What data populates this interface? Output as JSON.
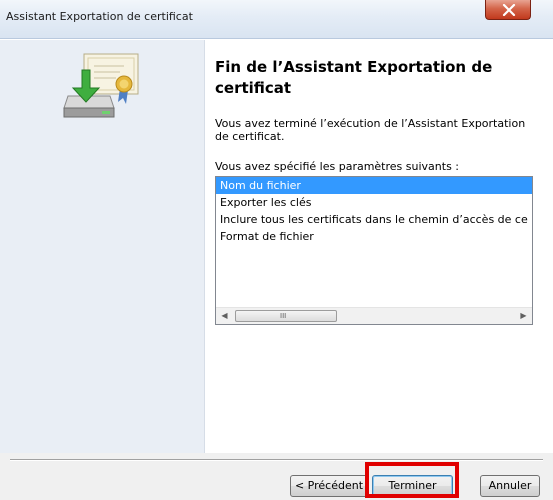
{
  "window": {
    "title": "Assistant Exportation de certificat",
    "close_icon": "close-icon"
  },
  "main": {
    "heading": "Fin de l’Assistant Exportation de certificat",
    "completion_text": "Vous avez terminé l’exécution de l’Assistant Exportation de certificat.",
    "params_label": "Vous avez spécifié les paramètres suivants :",
    "params_list": [
      "Nom du fichier",
      "Exporter les clés",
      "Inclure tous les certificats dans le chemin d’accès de ce",
      "Format de fichier"
    ],
    "selected_index": 0,
    "scrollbar_grip": "III"
  },
  "buttons": {
    "previous": "< Précédent",
    "finish": "Terminer",
    "cancel": "Annuler"
  },
  "colors": {
    "selection": "#3399ff",
    "highlight": "#e00000",
    "close_button": "#c1391d"
  }
}
